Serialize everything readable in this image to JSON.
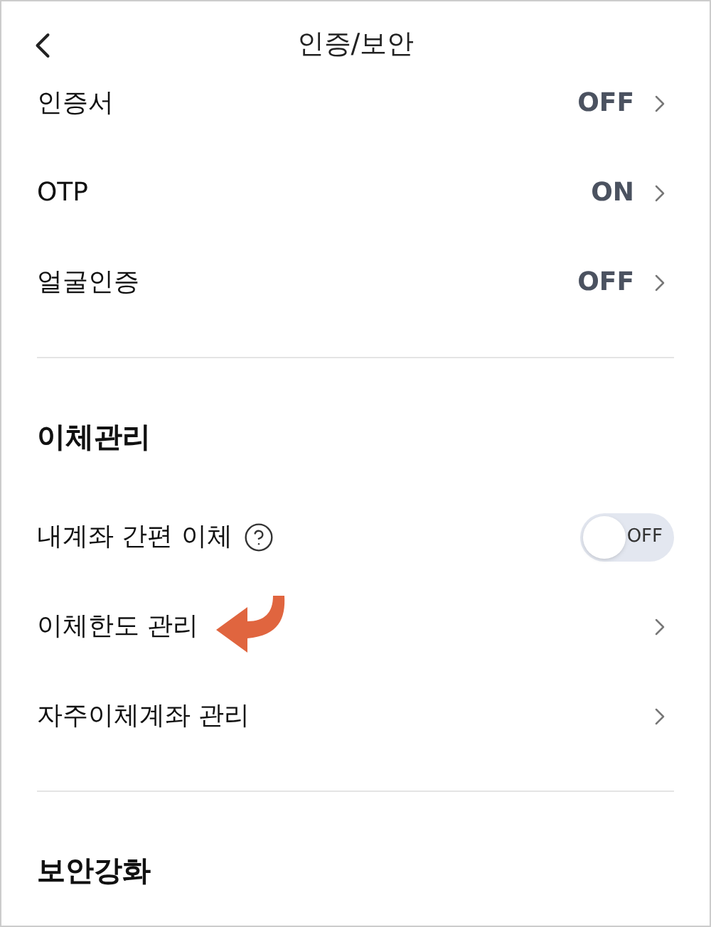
{
  "header": {
    "title": "인증/보안"
  },
  "sections": [
    {
      "items": [
        {
          "kind": "value",
          "label": "인증서",
          "value": "OFF"
        },
        {
          "kind": "value",
          "label": "OTP",
          "value": "ON"
        },
        {
          "kind": "value",
          "label": "얼굴인증",
          "value": "OFF"
        }
      ]
    },
    {
      "title": "이체관리",
      "items": [
        {
          "kind": "toggle",
          "label": "내계좌 간편 이체",
          "help": true,
          "on": false,
          "toggle_text": "OFF"
        },
        {
          "kind": "link",
          "label": "이체한도 관리",
          "annotated": true
        },
        {
          "kind": "link",
          "label": "자주이체계좌 관리"
        }
      ]
    },
    {
      "title": "보안강화"
    }
  ]
}
